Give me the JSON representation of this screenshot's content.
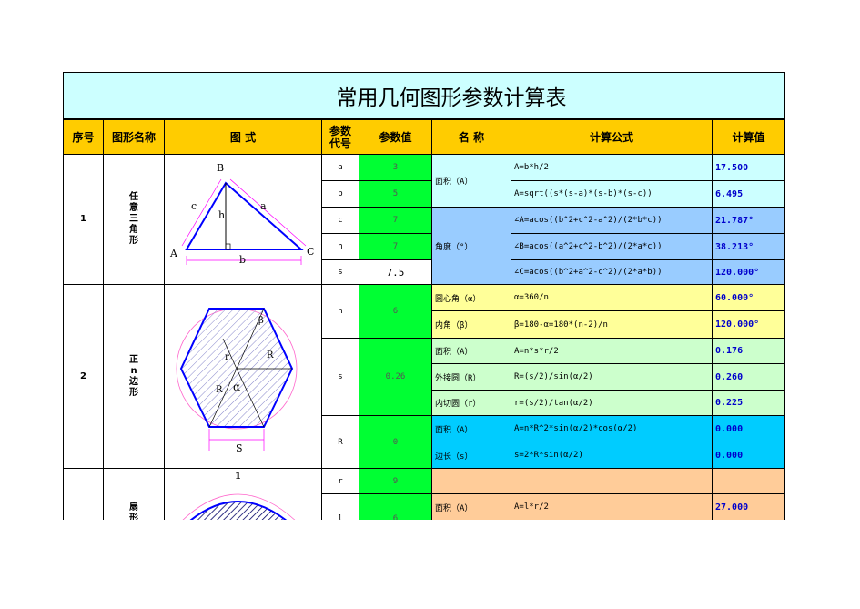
{
  "title": "常用几何图形参数计算表",
  "headers": [
    "序号",
    "图形名称",
    "图 式",
    "参数\n代号",
    "参数值",
    "名 称",
    "计算公式",
    "计算值"
  ],
  "rows": [
    {
      "no": "1",
      "name": "任\n意\n三\n角\n形",
      "figure_labels": {
        "A": "A",
        "B": "B",
        "C": "C",
        "a": "a",
        "b": "b",
        "c": "c",
        "h": "h"
      },
      "params": [
        {
          "code": "a",
          "value": "3"
        },
        {
          "code": "b",
          "value": "5"
        },
        {
          "code": "c",
          "value": "7"
        },
        {
          "code": "h",
          "value": "7"
        },
        {
          "code": "s",
          "value": "7.5"
        }
      ],
      "items": [
        {
          "name": "面积（A）",
          "formulas": [
            "A=b*h/2",
            "A=sqrt((s*(s-a)*(s-b)*(s-c))"
          ],
          "results": [
            "17.500",
            "6.495"
          ]
        },
        {
          "name": "角度（°）",
          "formulas": [
            "∠A=acos((b^2+c^2-a^2)/(2*b*c))",
            "∠B=acos((a^2+c^2-b^2)/(2*a*c))",
            "∠C=acos((b^2+a^2-c^2)/(2*a*b))"
          ],
          "results": [
            "21.787°",
            "38.213°",
            "120.000°"
          ]
        }
      ]
    },
    {
      "no": "2",
      "name": "正\nn\n边\n形",
      "figure_labels": {
        "beta": "β",
        "r": "r",
        "R1": "R",
        "R2": "R",
        "alpha": "α",
        "S": "S"
      },
      "params": [
        {
          "code": "n",
          "value": "6"
        },
        {
          "code": "s",
          "value": "0.26"
        },
        {
          "code": "R",
          "value": "0"
        }
      ],
      "items": [
        {
          "name": "圆心角（α）",
          "formula": "α=360/n",
          "result": "60.000°"
        },
        {
          "name": "内角（β）",
          "formula": "β=180-α=180*(n-2)/n",
          "result": "120.000°"
        },
        {
          "name": "面积（A）",
          "formula": "A=n*s*r/2",
          "result": "0.176"
        },
        {
          "name": "外接圆（R）",
          "formula": "R=(s/2)/sin(α/2)",
          "result": "0.260"
        },
        {
          "name": "内切圆（r）",
          "formula": "r=(s/2)/tan(α/2)",
          "result": "0.225"
        },
        {
          "name": "面积（A）",
          "formula": "A=n*R^2*sin(α/2)*cos(α/2)",
          "result": "0.000"
        },
        {
          "name": "边长（s）",
          "formula": "s=2*R*sin(α/2)",
          "result": "0.000"
        }
      ]
    },
    {
      "no": "",
      "name": "扇\n形",
      "figure_labels": {
        "l": "1"
      },
      "params": [
        {
          "code": "r",
          "value": "9"
        },
        {
          "code": "l",
          "value": "6"
        }
      ],
      "items": [
        {
          "name": "",
          "formula": "",
          "result": ""
        },
        {
          "name": "面积（A）",
          "formula": "A=l*r/2",
          "result": "27.000"
        }
      ]
    }
  ],
  "colors": {
    "header": "#ffcc00",
    "title_bg": "#ccffff",
    "param_value": "#00ff33",
    "angle_bg": "#99ccff",
    "yellow": "#ffff99",
    "green": "#ccffcc",
    "cyan": "#00ccff",
    "orange": "#ffcc99"
  }
}
